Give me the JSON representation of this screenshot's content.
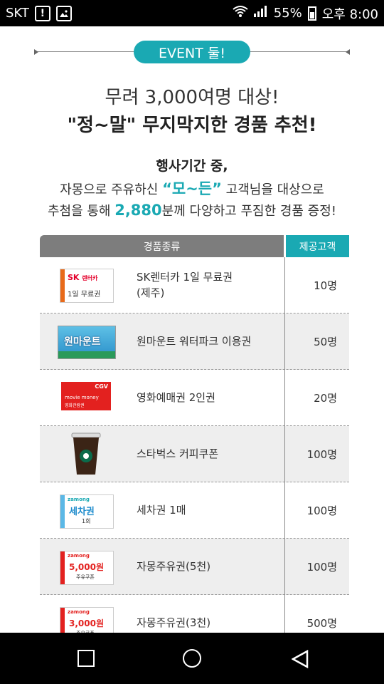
{
  "status": {
    "carrier": "SKT",
    "battery": "55%",
    "time": "오후 8:00"
  },
  "event": {
    "badge": "EVENT 둘!",
    "headline_line1": "무려 3,000여명 대상!",
    "headline_line2": "\"정~말\" 무지막지한 경품 추천!",
    "desc_line1": "행사기간 중,",
    "desc_line2_pre": "자몽으로 주유하신 ",
    "desc_line2_accent": "“모~든”",
    "desc_line2_post": " 고객님을 대상으로",
    "desc_line3_pre": "추첨을 통해 ",
    "desc_line3_accent": "2,880",
    "desc_line3_post": "분께 다양하고 푸짐한 경품 증정!"
  },
  "table": {
    "header_prize": "경품종류",
    "header_qty": "제공고객",
    "rows": [
      {
        "name": "SK렌터카 1일 무료권\n(제주)",
        "qty": "10명"
      },
      {
        "name": "원마운트 워터파크 이용권",
        "qty": "50명"
      },
      {
        "name": "영화예매권 2인권",
        "qty": "20명"
      },
      {
        "name": "스타벅스 커피쿠폰",
        "qty": "100명"
      },
      {
        "name": "세차권 1매",
        "qty": "100명"
      },
      {
        "name": "자몽주유권(5천)",
        "qty": "100명"
      },
      {
        "name": "자몽주유권(3천)",
        "qty": "500명"
      }
    ]
  },
  "thumbnails": {
    "sk_brand": "SK",
    "sk_sub": "렌터카",
    "sk_text": "1일 무료권",
    "onemount_text": "원마운트",
    "cgv_logo": "CGV",
    "movie_text": "movie money",
    "movie_sub": "영화관람권",
    "zamong_logo": "zamong",
    "wash_text": "세차권",
    "wash_sub": "1회",
    "fuel5_amount": "5,000원",
    "fuel3_amount": "3,000원",
    "fuel_sub": "주유쿠폰"
  },
  "colors": {
    "accent": "#1aa9b3",
    "header_gray": "#7d7d7d",
    "row_alt": "#eeeeee"
  }
}
